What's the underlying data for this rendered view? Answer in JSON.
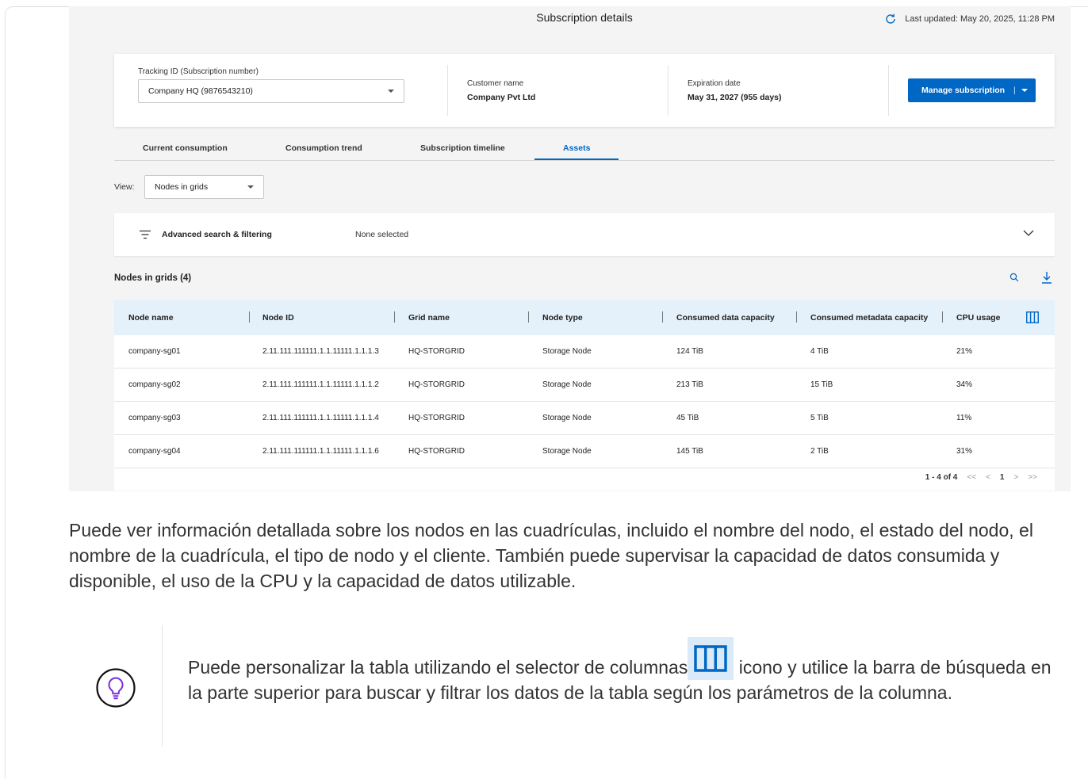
{
  "header": {
    "title": "Subscription details",
    "last_updated": "Last updated: May 20, 2025, 11:28 PM"
  },
  "subscription": {
    "tracking_label": "Tracking ID (Subscription number)",
    "tracking_value": "Company HQ (9876543210)",
    "customer_label": "Customer name",
    "customer_value": "Company Pvt Ltd",
    "expiration_label": "Expiration date",
    "expiration_value": "May 31, 2027 (955 days)",
    "manage_button": "Manage subscription",
    "manage_divider": "|"
  },
  "tabs": [
    {
      "label": "Current consumption"
    },
    {
      "label": "Consumption trend"
    },
    {
      "label": "Subscription timeline"
    },
    {
      "label": "Assets"
    }
  ],
  "active_tab": "Assets",
  "view": {
    "label": "View:",
    "value": "Nodes in grids"
  },
  "filter": {
    "label": "Advanced search & filtering",
    "value": "None selected"
  },
  "nodes": {
    "title": "Nodes in grids (4)",
    "columns": [
      "Node name",
      "Node ID",
      "Grid name",
      "Node type",
      "Consumed data capacity",
      "Consumed metadata capacity",
      "CPU usage"
    ],
    "rows": [
      [
        "company-sg01",
        "2.11.111.111111.1.1.11111.1.1.1.3",
        "HQ-STORGRID",
        "Storage Node",
        "124 TiB",
        "4 TiB",
        "21%"
      ],
      [
        "company-sg02",
        "2.11.111.111111.1.1.11111.1.1.1.2",
        "HQ-STORGRID",
        "Storage Node",
        "213 TiB",
        "15 TiB",
        "34%"
      ],
      [
        "company-sg03",
        "2.11.111.111111.1.1.11111.1.1.1.4",
        "HQ-STORGRID",
        "Storage Node",
        "45 TiB",
        "5 TiB",
        "11%"
      ],
      [
        "company-sg04",
        "2.11.111.111111.1.1.11111.1.1.1.6",
        "HQ-STORGRID",
        "Storage Node",
        "145 TiB",
        "2 TiB",
        "31%"
      ]
    ],
    "pagination": {
      "range": "1 - 4 of 4",
      "first": "<<",
      "prev": "<",
      "page": "1",
      "next": ">",
      "last": ">>"
    }
  },
  "doc": {
    "paragraph": "Puede ver información detallada sobre los nodos en las cuadrículas, incluido el nombre del nodo, el estado del nodo, el nombre de la cuadrícula, el tipo de nodo y el cliente. También puede supervisar la capacidad de datos consumida y disponible, el uso de la CPU y la capacidad de datos utilizable.",
    "tip_before": "Puede personalizar la tabla utilizando el selector de columnas",
    "tip_after": " icono y utilice la barra de búsqueda en la parte superior para buscar y filtrar los datos de la tabla según los parámetros de la columna."
  },
  "colors": {
    "accent": "#0067c5",
    "header_row": "#e4f1fb",
    "tip_icon": "#7b2fe0"
  },
  "icons": [
    "refresh-icon",
    "chevron-down-icon",
    "filter-icon",
    "search-icon",
    "download-icon",
    "columns-icon",
    "lightbulb-icon"
  ]
}
